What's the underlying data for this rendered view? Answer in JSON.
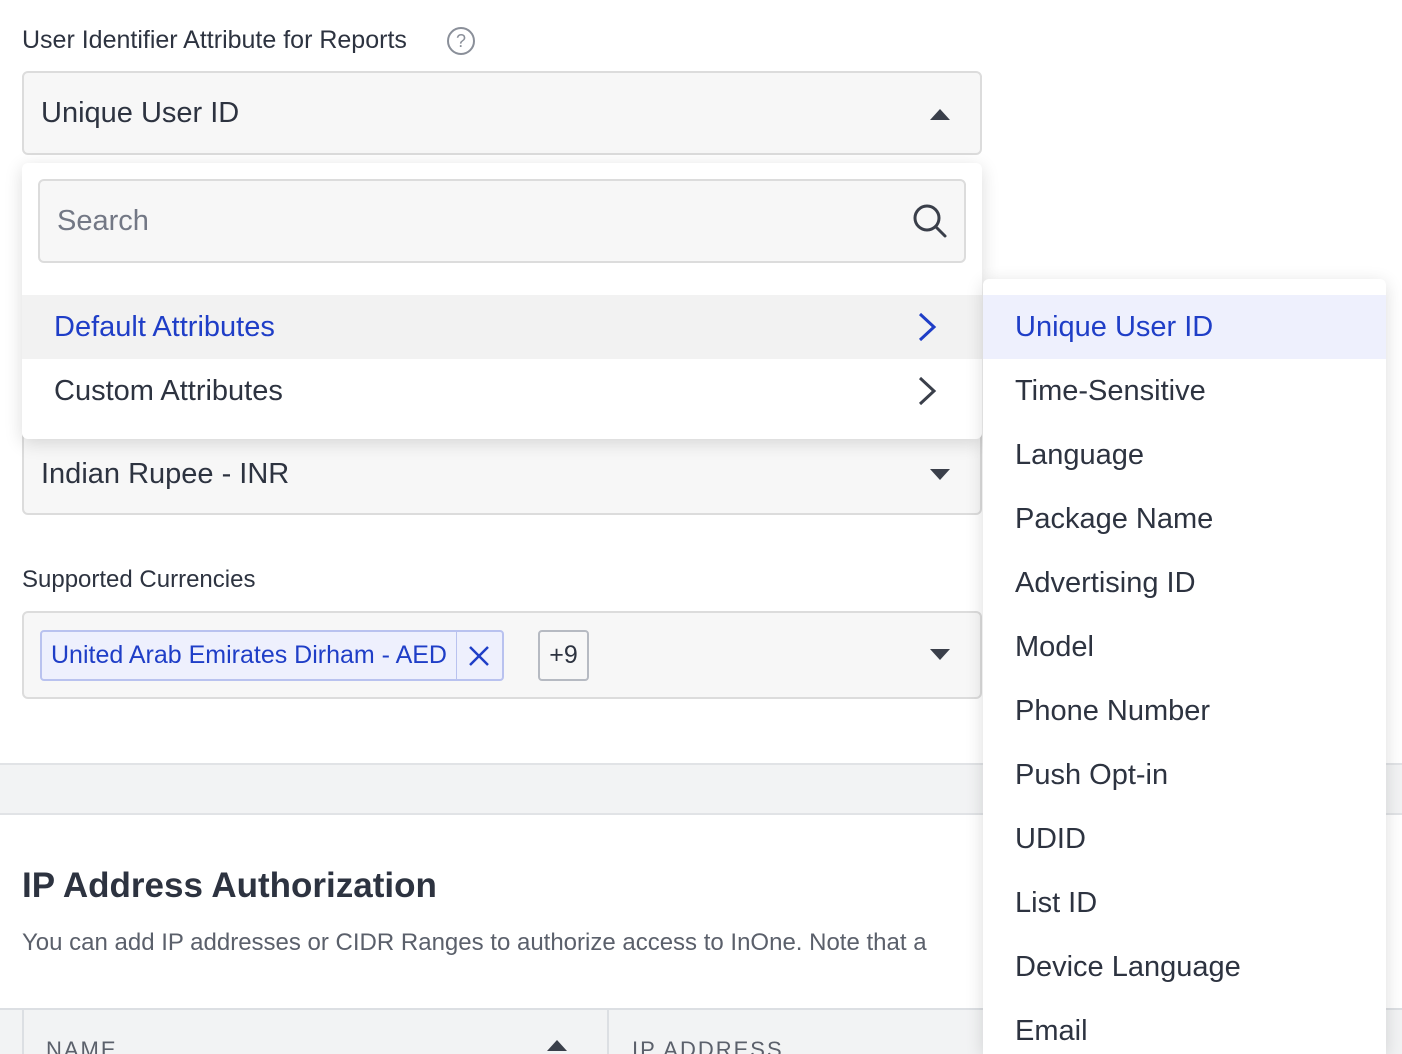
{
  "user_identifier": {
    "label": "User Identifier Attribute for Reports",
    "help_icon": "?",
    "selected": "Unique User ID"
  },
  "dropdown": {
    "search_placeholder": "Search",
    "groups": [
      {
        "label": "Default Attributes",
        "active": true
      },
      {
        "label": "Custom Attributes",
        "active": false
      }
    ]
  },
  "submenu": {
    "items": [
      {
        "label": "Unique User ID",
        "selected": true
      },
      {
        "label": "Time-Sensitive"
      },
      {
        "label": "Language"
      },
      {
        "label": "Package Name"
      },
      {
        "label": "Advertising ID"
      },
      {
        "label": "Model"
      },
      {
        "label": "Phone Number"
      },
      {
        "label": "Push Opt-in"
      },
      {
        "label": "UDID"
      },
      {
        "label": "List ID"
      },
      {
        "label": "Device Language"
      },
      {
        "label": "Email"
      }
    ]
  },
  "base_currency": {
    "selected": "Indian Rupee - INR"
  },
  "supported_currencies": {
    "label": "Supported Currencies",
    "tags": [
      "United Arab Emirates Dirham - AED"
    ],
    "more_count": "+9"
  },
  "ip_section": {
    "title": "IP Address Authorization",
    "description": "You can add IP addresses or CIDR Ranges to authorize access to InOne. Note that a",
    "columns": [
      "NAME",
      "IP ADDRESS"
    ]
  },
  "colors": {
    "accent": "#1f3ec7",
    "selected_bg": "#eef0fd",
    "text": "#2d3340"
  }
}
